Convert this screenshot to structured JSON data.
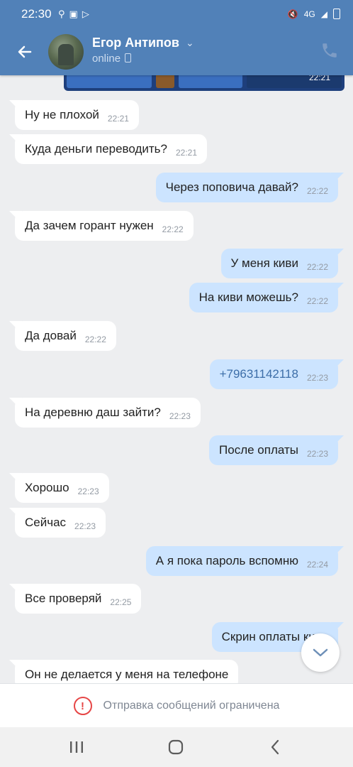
{
  "status_bar": {
    "time": "22:30",
    "network": "4G"
  },
  "header": {
    "name": "Егор Антипов",
    "status": "online"
  },
  "image_preview": {
    "time": "22:21"
  },
  "messages": [
    {
      "dir": "in",
      "text": "Ну не плохой",
      "time": "22:21"
    },
    {
      "dir": "in",
      "text": "Куда деньги переводить?",
      "time": "22:21"
    },
    {
      "dir": "out",
      "text": "Через поповича давай?",
      "time": "22:22"
    },
    {
      "dir": "in",
      "text": "Да зачем горант нужен",
      "time": "22:22"
    },
    {
      "dir": "out",
      "text": "У меня киви",
      "time": "22:22"
    },
    {
      "dir": "out",
      "text": "На киви можешь?",
      "time": "22:22"
    },
    {
      "dir": "in",
      "text": "Да довай",
      "time": "22:22"
    },
    {
      "dir": "out",
      "text": "+79631142118",
      "time": "22:23"
    },
    {
      "dir": "in",
      "text": "На деревню даш зайти?",
      "time": "22:23"
    },
    {
      "dir": "out",
      "text": "После оплаты",
      "time": "22:23"
    },
    {
      "dir": "in",
      "text": "Хорошо",
      "time": "22:23"
    },
    {
      "dir": "in",
      "text": "Сейчас",
      "time": "22:23"
    },
    {
      "dir": "out",
      "text": "А я пока пароль вспомню",
      "time": "22:24"
    },
    {
      "dir": "in",
      "text": "Все проверяй",
      "time": "22:25"
    },
    {
      "dir": "out",
      "text": "Скрин оплаты кинь",
      "time": ""
    },
    {
      "dir": "in",
      "text": "Он не делается у меня на телефоне",
      "time": ""
    }
  ],
  "restriction": {
    "text": "Отправка сообщений ограничена"
  },
  "colors": {
    "header": "#5181b8",
    "incoming": "#ffffff",
    "outgoing": "#cce4ff",
    "background": "#edeef0",
    "warning": "#e64646"
  }
}
